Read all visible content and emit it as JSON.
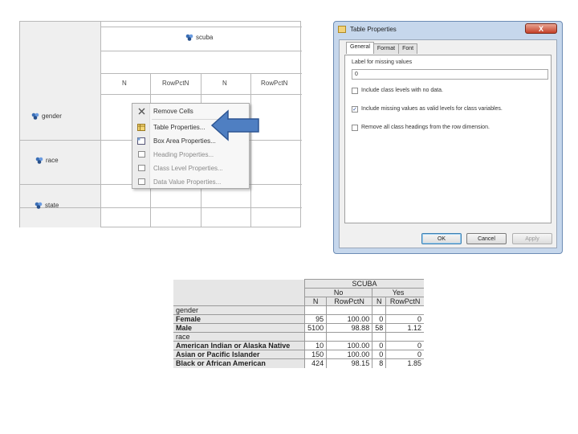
{
  "designer": {
    "column_var": "scuba",
    "col_headers": [
      "N",
      "RowPctN",
      "N",
      "RowPctN"
    ],
    "row_vars": [
      "gender",
      "race",
      "state"
    ],
    "var_icon": "class-variable-icon"
  },
  "context_menu": {
    "items": [
      {
        "label": "Remove Cells",
        "icon": "remove-x-icon",
        "enabled": true
      },
      {
        "label": "Table Properties...",
        "icon": "table-icon",
        "enabled": true
      },
      {
        "label": "Box Area Properties...",
        "icon": "box-area-icon",
        "enabled": true
      },
      {
        "label": "Heading Properties...",
        "icon": "heading-icon",
        "enabled": false
      },
      {
        "label": "Class Level Properties...",
        "icon": "class-level-icon",
        "enabled": false
      },
      {
        "label": "Data Value Properties...",
        "icon": "data-value-icon",
        "enabled": false
      }
    ],
    "arrow_color": "#4f7fc2"
  },
  "dialog": {
    "title": "Table Properties",
    "close_label": "X",
    "tabs": [
      "General",
      "Format",
      "Font"
    ],
    "missing_label": "Label for missing values",
    "missing_value": "0",
    "options": [
      {
        "label": "Include class levels with no data.",
        "checked": false
      },
      {
        "label": "Include missing values as valid levels for class variables.",
        "checked": true
      },
      {
        "label": "Remove all class headings from the row dimension.",
        "checked": false
      }
    ],
    "buttons": {
      "ok": "OK",
      "cancel": "Cancel",
      "apply": "Apply"
    }
  },
  "output": {
    "column_var": "SCUBA",
    "levels": [
      "No",
      "Yes"
    ],
    "stats": [
      "N",
      "RowPctN",
      "N",
      "RowPctN"
    ],
    "rows": [
      {
        "label": "gender",
        "heading": true,
        "values": [
          "",
          "",
          "",
          ""
        ]
      },
      {
        "label": "Female",
        "heading": false,
        "values": [
          "95",
          "100.00",
          "0",
          "0"
        ]
      },
      {
        "label": "Male",
        "heading": false,
        "values": [
          "5100",
          "98.88",
          "58",
          "1.12"
        ]
      },
      {
        "label": "race",
        "heading": true,
        "values": [
          "",
          "",
          "",
          ""
        ]
      },
      {
        "label": "American Indian or Alaska Native",
        "heading": false,
        "values": [
          "10",
          "100.00",
          "0",
          "0"
        ]
      },
      {
        "label": "Asian or Pacific Islander",
        "heading": false,
        "values": [
          "150",
          "100.00",
          "0",
          "0"
        ]
      },
      {
        "label": "Black or African American",
        "heading": false,
        "values": [
          "424",
          "98.15",
          "8",
          "1.85"
        ]
      }
    ]
  }
}
